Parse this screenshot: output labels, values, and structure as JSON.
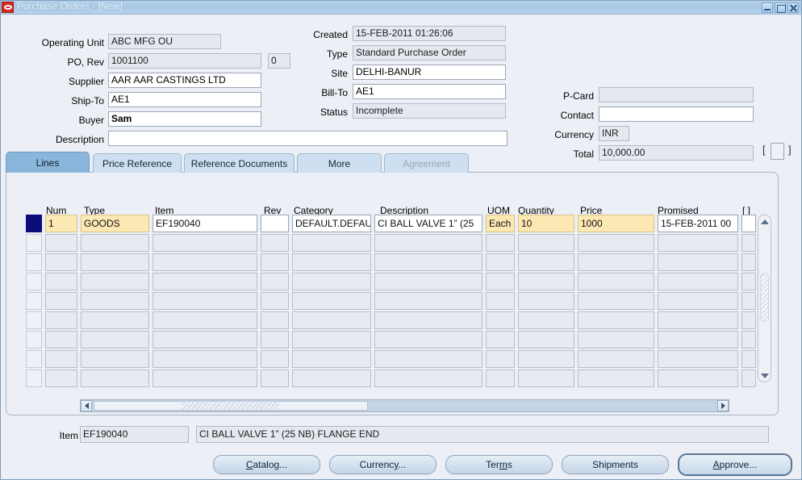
{
  "window": {
    "title": "Purchase Orders - [New]",
    "logo_icon": "oracle-logo-icon",
    "minimize_label": "Minimize",
    "maximize_label": "Maximize",
    "close_label": "Close"
  },
  "header": {
    "left": [
      {
        "label": "Operating Unit",
        "value": "ABC MFG OU",
        "readonly": true,
        "bold_first": true
      },
      {
        "label": "PO, Rev",
        "value": "1001100",
        "readonly": true
      },
      {
        "label": "Supplier",
        "value": "AAR AAR CASTINGS LTD",
        "readonly": false
      },
      {
        "label": "Ship-To",
        "value": "AE1",
        "readonly": false
      },
      {
        "label": "Buyer",
        "value": "Sam",
        "readonly": false
      },
      {
        "label": "Description",
        "value": "",
        "readonly": false
      }
    ],
    "rev_value": "0",
    "middle": [
      {
        "label": "Created",
        "value": "15-FEB-2011 01:26:06",
        "readonly": true
      },
      {
        "label": "Type",
        "value": "Standard Purchase Order",
        "readonly": true
      },
      {
        "label": "Site",
        "value": "DELHI-BANUR",
        "readonly": false
      },
      {
        "label": "Bill-To",
        "value": "AE1",
        "readonly": false
      },
      {
        "label": "Status",
        "value": "Incomplete",
        "readonly": true
      }
    ],
    "right": [
      {
        "label": "P-Card",
        "value": "",
        "readonly": true
      },
      {
        "label": "Contact",
        "value": "",
        "readonly": false
      },
      {
        "label": "Currency",
        "value": "INR",
        "readonly": true
      },
      {
        "label": "Total",
        "value": "10,000.00",
        "readonly": true
      }
    ],
    "dff_bracket_open": "[",
    "dff_bracket_close": "]"
  },
  "tabs": [
    {
      "label": "Lines",
      "active": true,
      "disabled": false
    },
    {
      "label": "Price Reference",
      "active": false,
      "disabled": false
    },
    {
      "label": "Reference Documents",
      "active": false,
      "disabled": false
    },
    {
      "label": "More",
      "active": false,
      "disabled": false
    },
    {
      "label": "Agreement",
      "active": false,
      "disabled": true
    }
  ],
  "grid": {
    "columns": [
      "Num",
      "Type",
      "Item",
      "Rev",
      "Category",
      "Description",
      "UOM",
      "Quantity",
      "Price",
      "Promised",
      "[ ]"
    ],
    "rows": [
      {
        "selected": true,
        "cells": {
          "Num": "1",
          "Type": "GOODS",
          "Item": "EF190040",
          "Rev": "",
          "Category": "DEFAULT.DEFAU",
          "Description": "CI BALL VALVE 1” (25",
          "UOM": "Each",
          "Quantity": "10",
          "Price": "1000",
          "Promised": "15-FEB-2011 00",
          "[ ]": ""
        }
      },
      {
        "selected": false,
        "cells": {}
      },
      {
        "selected": false,
        "cells": {}
      },
      {
        "selected": false,
        "cells": {}
      },
      {
        "selected": false,
        "cells": {}
      },
      {
        "selected": false,
        "cells": {}
      },
      {
        "selected": false,
        "cells": {}
      },
      {
        "selected": false,
        "cells": {}
      },
      {
        "selected": false,
        "cells": {}
      }
    ],
    "highlighted_columns": [
      "Num",
      "Type",
      "UOM",
      "Quantity",
      "Price"
    ],
    "vertical_scrollbar": {
      "up_icon": "scroll-up-icon",
      "down_icon": "scroll-down-icon"
    },
    "horizontal_scrollbar": {
      "left_icon": "scroll-left-icon",
      "right_icon": "scroll-right-icon"
    }
  },
  "detail": {
    "item_label": "Item",
    "item_code": "EF190040",
    "item_description": "CI BALL VALVE 1” (25 NB) FLANGE END"
  },
  "buttons": [
    {
      "label": "Catalog...",
      "mnemonic": "C",
      "default": false
    },
    {
      "label": "Currency...",
      "mnemonic": "y",
      "default": false
    },
    {
      "label": "Terms",
      "mnemonic": "m",
      "default": false
    },
    {
      "label": "Shipments",
      "mnemonic": "",
      "default": false
    },
    {
      "label": "Approve...",
      "mnemonic": "A",
      "default": true
    }
  ],
  "colors": {
    "window_background": "#eceff5",
    "titlebar": "#a6c6e3",
    "active_tab": "#8bb6dc",
    "inactive_tab": "#cddff0",
    "highlight_field": "#fce8b2",
    "selected_row_marker": "#0b0b7a",
    "readonly_field": "#e4e8ef",
    "oracle_red": "#d42a20"
  }
}
